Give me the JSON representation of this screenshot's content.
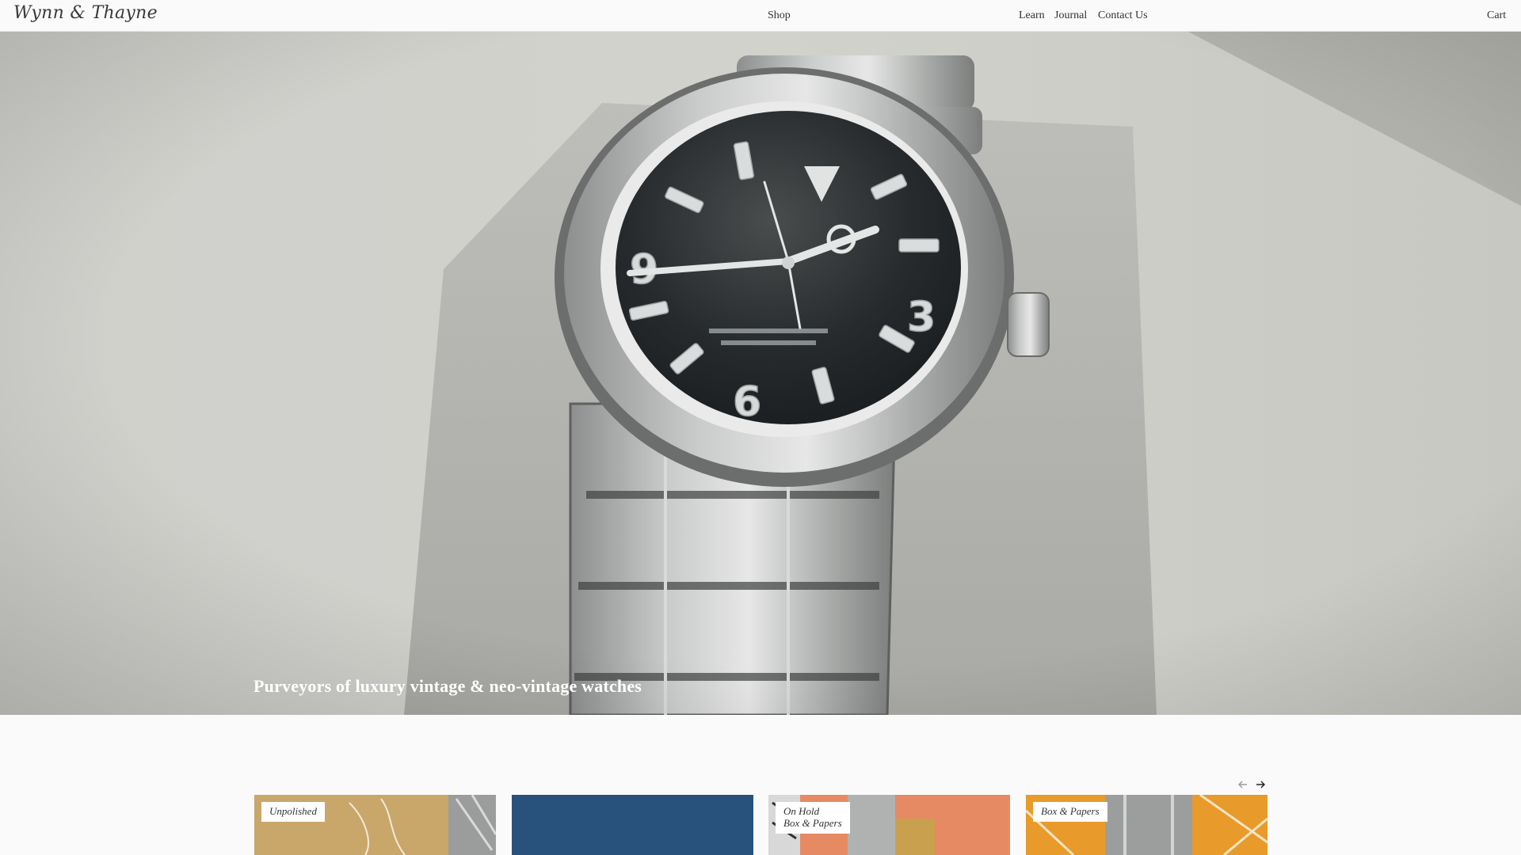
{
  "header": {
    "logo": "Wynn & Thayne",
    "nav": {
      "shop": "Shop",
      "learn": "Learn",
      "journal": "Journal",
      "contact": "Contact Us",
      "cart": "Cart"
    }
  },
  "hero": {
    "tagline": "Purveyors of luxury vintage & neo-vintage watches",
    "dial_numerals": {
      "n9": "9",
      "n3": "3",
      "n6": "6"
    }
  },
  "carousel": {
    "prev_icon": "arrow-left-icon",
    "next_icon": "arrow-right-icon",
    "cards": [
      {
        "badge_line1": "Unpolished",
        "badge_line2": ""
      },
      {
        "badge_line1": "",
        "badge_line2": ""
      },
      {
        "badge_line1": "On Hold",
        "badge_line2": "Box & Papers"
      },
      {
        "badge_line1": "Box & Papers",
        "badge_line2": ""
      }
    ]
  },
  "colors": {
    "background": "#fafafa",
    "hero_gray": "#c9c9c4",
    "card_tan": "#c9a76a",
    "card_blue": "#2d5a86",
    "card_coral": "#e58a63",
    "card_orange": "#e89a2a"
  }
}
